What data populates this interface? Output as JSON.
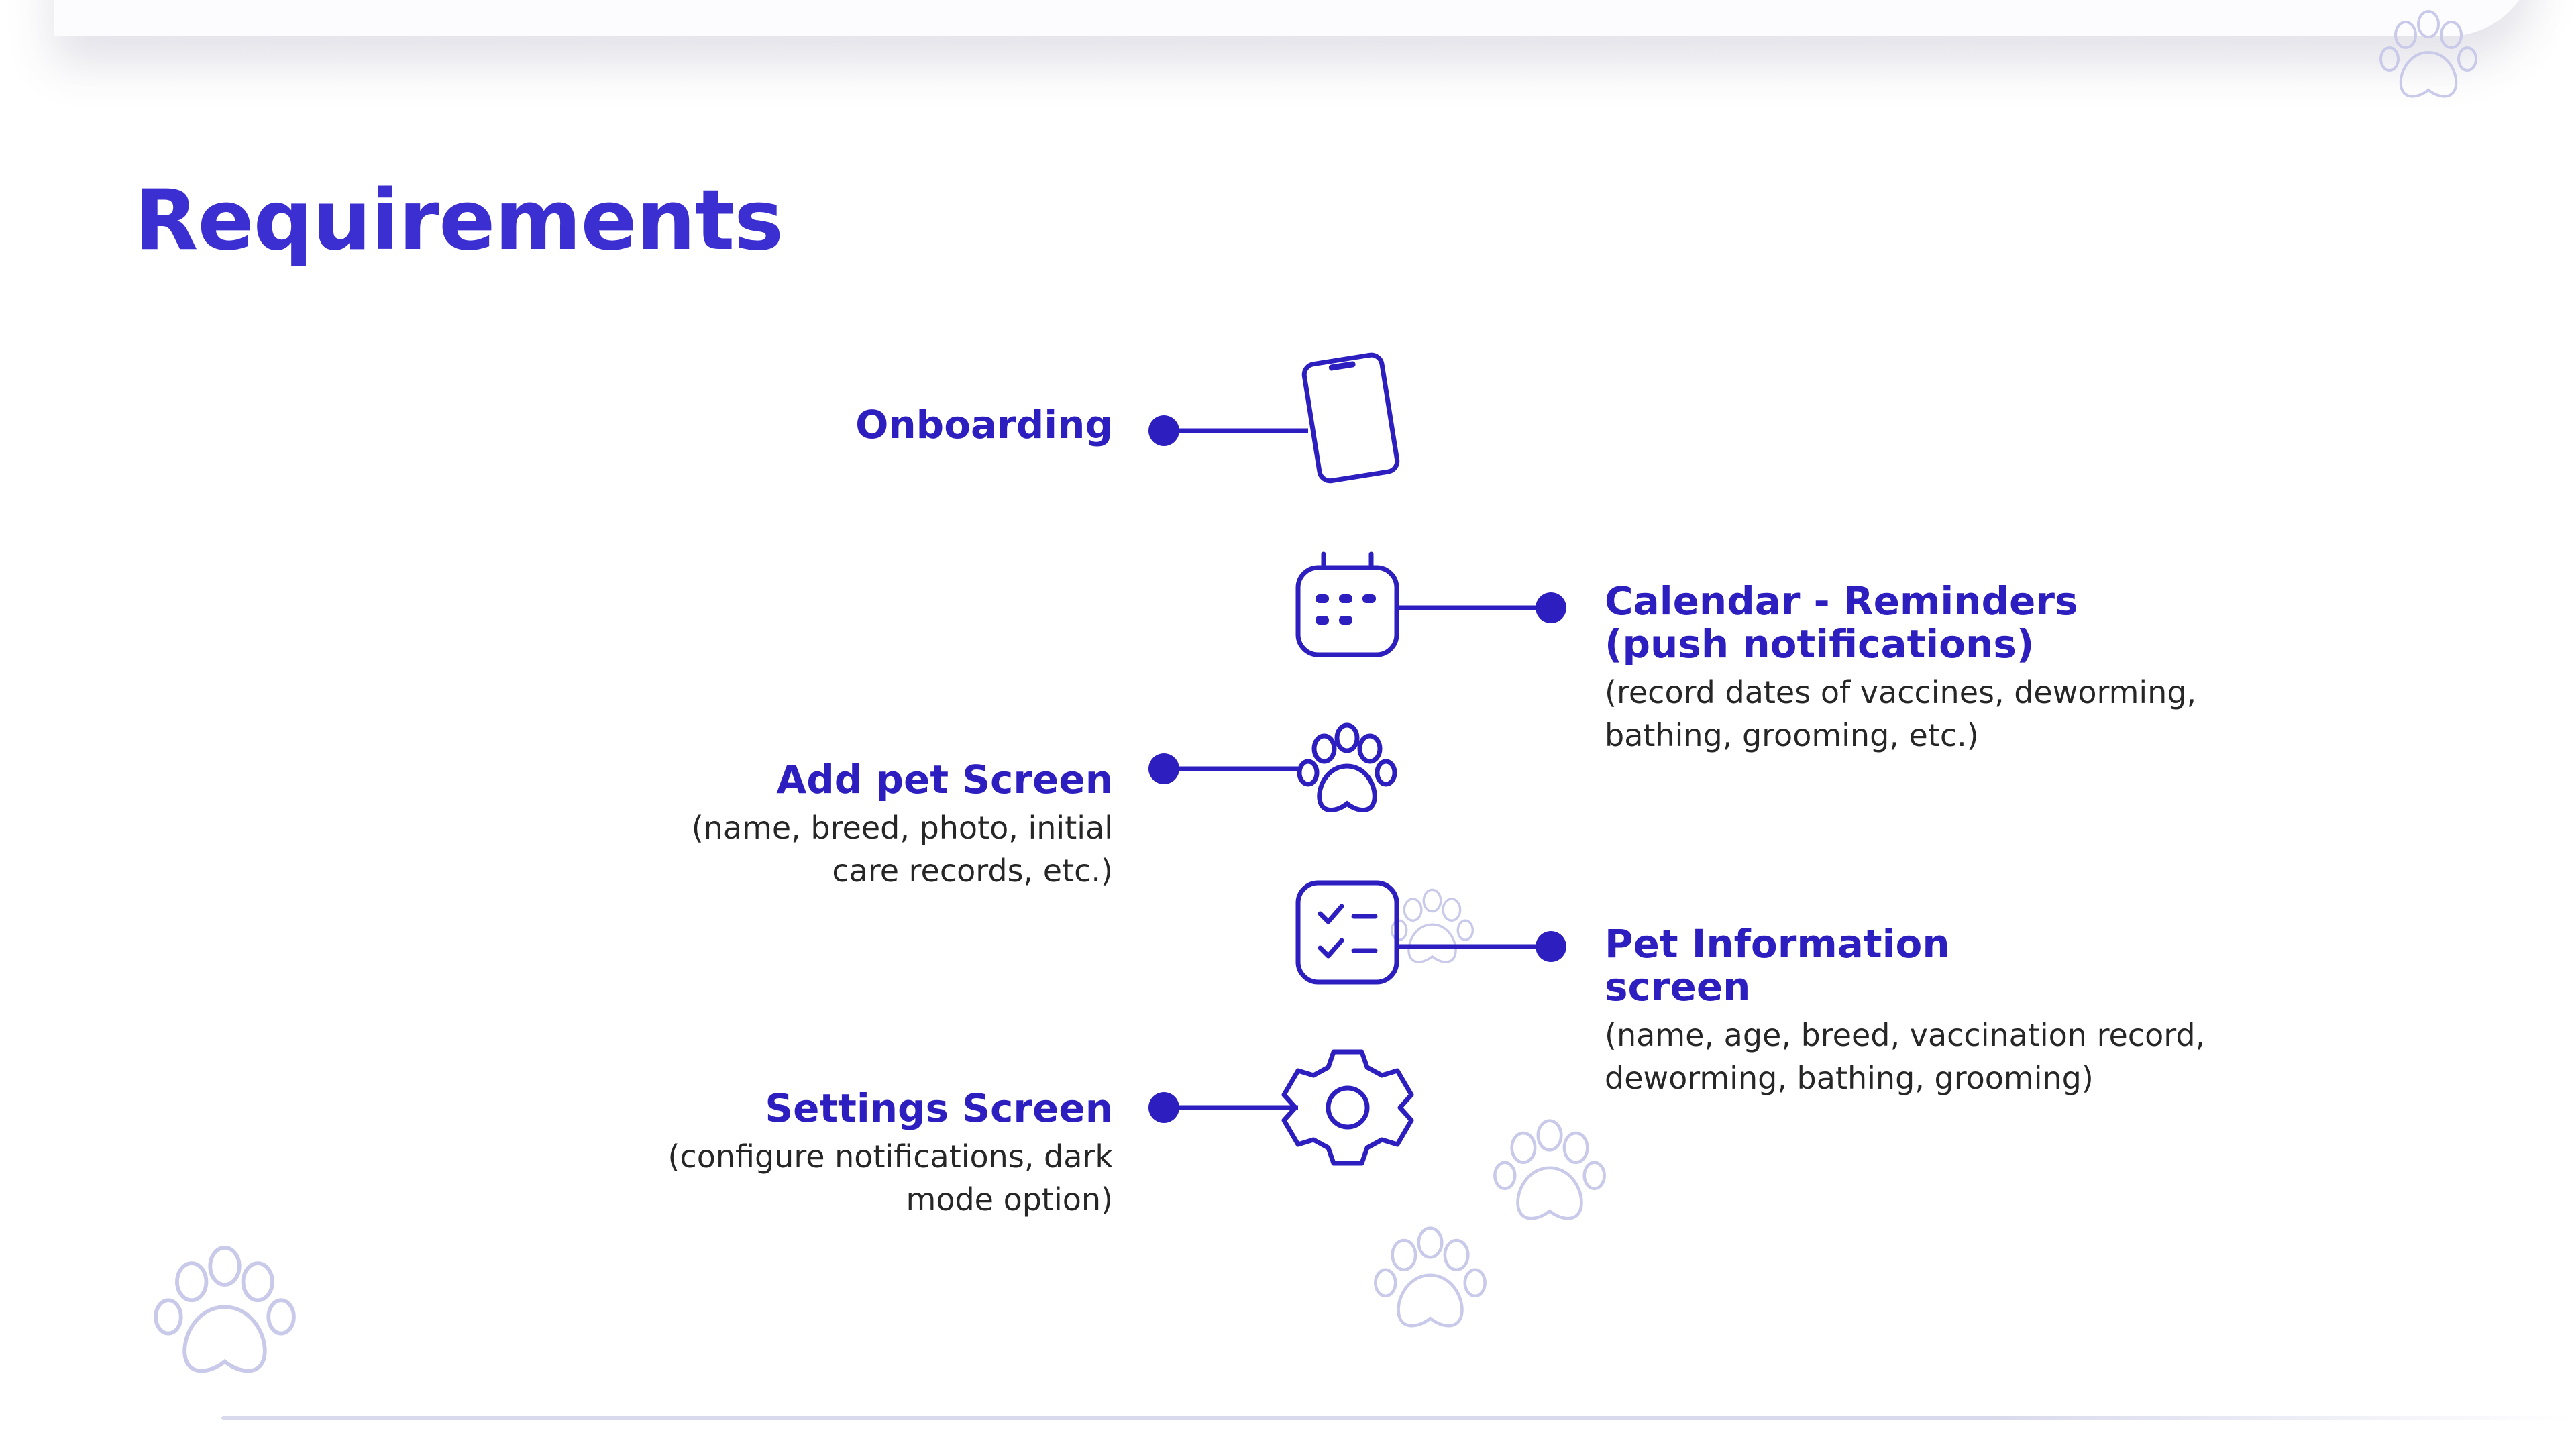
{
  "page": {
    "title": "Requirements"
  },
  "colors": {
    "accent": "#2d1fbf",
    "title": "#3b2fd1",
    "body_text": "#262626",
    "decoration": "#c9caea"
  },
  "requirements": [
    {
      "heading": "Onboarding",
      "description": "",
      "icon": "smartphone-icon",
      "side": "left"
    },
    {
      "heading_lines": [
        "Calendar - Reminders",
        "(push notifications)"
      ],
      "description_lines": [
        "(record dates of vaccines, deworming,",
        "bathing, grooming, etc.)"
      ],
      "icon": "calendar-icon",
      "side": "right"
    },
    {
      "heading": "Add pet Screen",
      "description_lines": [
        "(name, breed, photo, initial",
        "care records, etc.)"
      ],
      "icon": "paw-icon",
      "side": "left"
    },
    {
      "heading_lines": [
        "Pet Information",
        "screen"
      ],
      "description_lines": [
        "(name, age, breed, vaccination record,",
        "deworming, bathing, grooming)"
      ],
      "icon": "checklist-icon",
      "side": "right"
    },
    {
      "heading": "Settings Screen",
      "description_lines": [
        "(configure notifications, dark",
        "mode option)"
      ],
      "icon": "gear-icon",
      "side": "left"
    }
  ]
}
